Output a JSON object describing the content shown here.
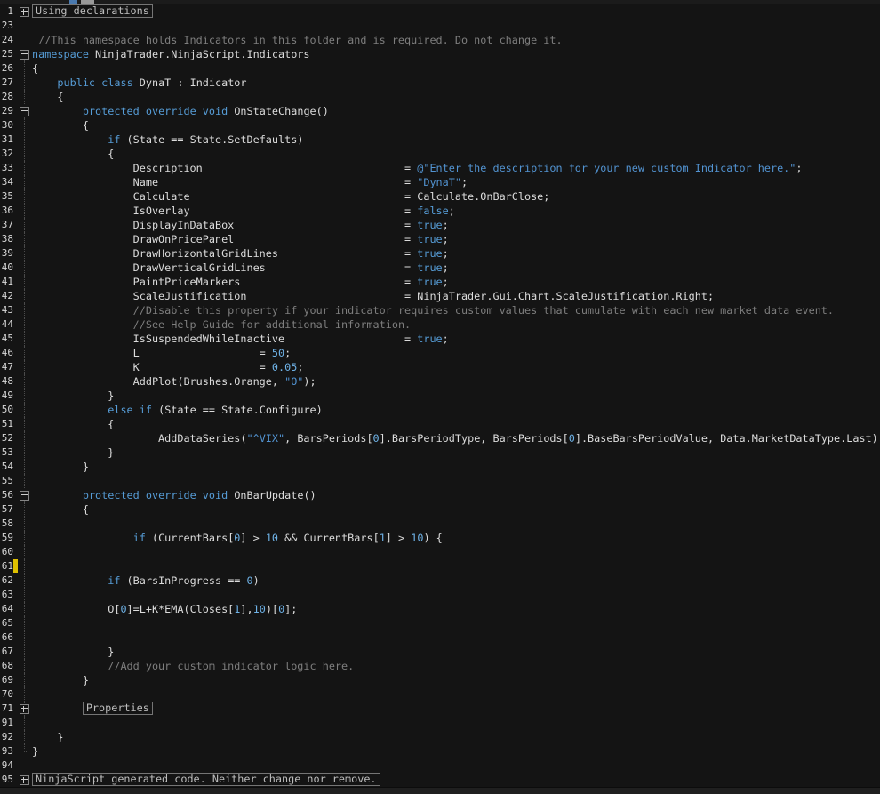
{
  "editor": {
    "colors": {
      "background": "#141414",
      "plain": "#dcdcdc",
      "keyword": "#569cd6",
      "string": "#5293d1",
      "number": "#6fb3e8",
      "comment": "#7e7e7e",
      "line_number": "#d8d8d8",
      "fold_border": "#858585",
      "fold_glyph": "#cccccc",
      "guide": "#4b4b4b",
      "boxed_text": "#bdbdbd",
      "boxed_border": "#757575",
      "change_marker": "#dfc000",
      "top_strip": "#1b1b1b",
      "bottom_strip": "#1f1f1f"
    },
    "collapsed_regions": [
      "Using declarations",
      "Properties",
      "NinjaScript generated code. Neither change nor remove."
    ],
    "lines": [
      {
        "num": "1",
        "fold": "plus",
        "tokens": [
          {
            "s": "Using declarations",
            "c": "boxed"
          }
        ]
      },
      {
        "num": "23",
        "fold": "",
        "tokens": []
      },
      {
        "num": "24",
        "fold": "",
        "tokens": [
          {
            "s": " //This namespace holds Indicators in this folder and is required. Do not change it.",
            "c": "com"
          }
        ]
      },
      {
        "num": "25",
        "fold": "minus",
        "tokens": [
          {
            "s": "namespace",
            "c": "kw"
          },
          {
            "s": " NinjaTrader.NinjaScript.Indicators",
            "c": "plain"
          }
        ]
      },
      {
        "num": "26",
        "fold": "line",
        "tokens": [
          {
            "s": "{",
            "c": "plain"
          }
        ]
      },
      {
        "num": "27",
        "fold": "line",
        "tokens": [
          {
            "s": "    ",
            "c": "plain"
          },
          {
            "s": "public",
            "c": "kw"
          },
          {
            "s": " ",
            "c": "plain"
          },
          {
            "s": "class",
            "c": "kw"
          },
          {
            "s": " DynaT : Indicator",
            "c": "plain"
          }
        ]
      },
      {
        "num": "28",
        "fold": "line",
        "tokens": [
          {
            "s": "    {",
            "c": "plain"
          }
        ]
      },
      {
        "num": "29",
        "fold": "minus",
        "tokens": [
          {
            "s": "        ",
            "c": "plain"
          },
          {
            "s": "protected",
            "c": "kw"
          },
          {
            "s": " ",
            "c": "plain"
          },
          {
            "s": "override",
            "c": "kw"
          },
          {
            "s": " ",
            "c": "plain"
          },
          {
            "s": "void",
            "c": "kw"
          },
          {
            "s": " OnStateChange()",
            "c": "plain"
          }
        ]
      },
      {
        "num": "30",
        "fold": "line",
        "tokens": [
          {
            "s": "        {",
            "c": "plain"
          }
        ]
      },
      {
        "num": "31",
        "fold": "line",
        "tokens": [
          {
            "s": "            ",
            "c": "plain"
          },
          {
            "s": "if",
            "c": "kw"
          },
          {
            "s": " (State == State.SetDefaults)",
            "c": "plain"
          }
        ]
      },
      {
        "num": "32",
        "fold": "line",
        "tokens": [
          {
            "s": "            {",
            "c": "plain"
          }
        ]
      },
      {
        "num": "33",
        "fold": "line",
        "tokens": [
          {
            "s": "                Description                                = ",
            "c": "plain"
          },
          {
            "s": "@\"Enter the description for your new custom Indicator here.\"",
            "c": "str"
          },
          {
            "s": ";",
            "c": "plain"
          }
        ]
      },
      {
        "num": "34",
        "fold": "line",
        "tokens": [
          {
            "s": "                Name                                       = ",
            "c": "plain"
          },
          {
            "s": "\"DynaT\"",
            "c": "str"
          },
          {
            "s": ";",
            "c": "plain"
          }
        ]
      },
      {
        "num": "35",
        "fold": "line",
        "tokens": [
          {
            "s": "                Calculate                                  = Calculate.OnBarClose;",
            "c": "plain"
          }
        ]
      },
      {
        "num": "36",
        "fold": "line",
        "tokens": [
          {
            "s": "                IsOverlay                                  = ",
            "c": "plain"
          },
          {
            "s": "false",
            "c": "kw"
          },
          {
            "s": ";",
            "c": "plain"
          }
        ]
      },
      {
        "num": "37",
        "fold": "line",
        "tokens": [
          {
            "s": "                DisplayInDataBox                           = ",
            "c": "plain"
          },
          {
            "s": "true",
            "c": "kw"
          },
          {
            "s": ";",
            "c": "plain"
          }
        ]
      },
      {
        "num": "38",
        "fold": "line",
        "tokens": [
          {
            "s": "                DrawOnPricePanel                           = ",
            "c": "plain"
          },
          {
            "s": "true",
            "c": "kw"
          },
          {
            "s": ";",
            "c": "plain"
          }
        ]
      },
      {
        "num": "39",
        "fold": "line",
        "tokens": [
          {
            "s": "                DrawHorizontalGridLines                    = ",
            "c": "plain"
          },
          {
            "s": "true",
            "c": "kw"
          },
          {
            "s": ";",
            "c": "plain"
          }
        ]
      },
      {
        "num": "40",
        "fold": "line",
        "tokens": [
          {
            "s": "                DrawVerticalGridLines                      = ",
            "c": "plain"
          },
          {
            "s": "true",
            "c": "kw"
          },
          {
            "s": ";",
            "c": "plain"
          }
        ]
      },
      {
        "num": "41",
        "fold": "line",
        "tokens": [
          {
            "s": "                PaintPriceMarkers                          = ",
            "c": "plain"
          },
          {
            "s": "true",
            "c": "kw"
          },
          {
            "s": ";",
            "c": "plain"
          }
        ]
      },
      {
        "num": "42",
        "fold": "line",
        "tokens": [
          {
            "s": "                ScaleJustification                         = NinjaTrader.Gui.Chart.ScaleJustification.Right;",
            "c": "plain"
          }
        ]
      },
      {
        "num": "43",
        "fold": "line",
        "tokens": [
          {
            "s": "                ",
            "c": "plain"
          },
          {
            "s": "//Disable this property if your indicator requires custom values that cumulate with each new market data event.",
            "c": "com"
          }
        ]
      },
      {
        "num": "44",
        "fold": "line",
        "tokens": [
          {
            "s": "                ",
            "c": "plain"
          },
          {
            "s": "//See Help Guide for additional information.",
            "c": "com"
          }
        ]
      },
      {
        "num": "45",
        "fold": "line",
        "tokens": [
          {
            "s": "                IsSuspendedWhileInactive                   = ",
            "c": "plain"
          },
          {
            "s": "true",
            "c": "kw"
          },
          {
            "s": ";",
            "c": "plain"
          }
        ]
      },
      {
        "num": "46",
        "fold": "line",
        "tokens": [
          {
            "s": "                L                   = ",
            "c": "plain"
          },
          {
            "s": "50",
            "c": "num"
          },
          {
            "s": ";",
            "c": "plain"
          }
        ]
      },
      {
        "num": "47",
        "fold": "line",
        "tokens": [
          {
            "s": "                K                   = ",
            "c": "plain"
          },
          {
            "s": "0.05",
            "c": "num"
          },
          {
            "s": ";",
            "c": "plain"
          }
        ]
      },
      {
        "num": "48",
        "fold": "line",
        "tokens": [
          {
            "s": "                AddPlot(Brushes.Orange, ",
            "c": "plain"
          },
          {
            "s": "\"O\"",
            "c": "str"
          },
          {
            "s": ");",
            "c": "plain"
          }
        ]
      },
      {
        "num": "49",
        "fold": "line",
        "tokens": [
          {
            "s": "            }",
            "c": "plain"
          }
        ]
      },
      {
        "num": "50",
        "fold": "line",
        "tokens": [
          {
            "s": "            ",
            "c": "plain"
          },
          {
            "s": "else",
            "c": "kw"
          },
          {
            "s": " ",
            "c": "plain"
          },
          {
            "s": "if",
            "c": "kw"
          },
          {
            "s": " (State == State.Configure)",
            "c": "plain"
          }
        ]
      },
      {
        "num": "51",
        "fold": "line",
        "tokens": [
          {
            "s": "            {",
            "c": "plain"
          }
        ]
      },
      {
        "num": "52",
        "fold": "line",
        "tokens": [
          {
            "s": "                    AddDataSeries(",
            "c": "plain"
          },
          {
            "s": "\"^VIX\"",
            "c": "str"
          },
          {
            "s": ", BarsPeriods[",
            "c": "plain"
          },
          {
            "s": "0",
            "c": "num"
          },
          {
            "s": "].BarsPeriodType, BarsPeriods[",
            "c": "plain"
          },
          {
            "s": "0",
            "c": "num"
          },
          {
            "s": "].BaseBarsPeriodValue, Data.MarketDataType.Last);",
            "c": "plain"
          }
        ]
      },
      {
        "num": "53",
        "fold": "line",
        "tokens": [
          {
            "s": "            }",
            "c": "plain"
          }
        ]
      },
      {
        "num": "54",
        "fold": "line",
        "tokens": [
          {
            "s": "        }",
            "c": "plain"
          }
        ]
      },
      {
        "num": "55",
        "fold": "line",
        "tokens": []
      },
      {
        "num": "56",
        "fold": "minus",
        "tokens": [
          {
            "s": "        ",
            "c": "plain"
          },
          {
            "s": "protected",
            "c": "kw"
          },
          {
            "s": " ",
            "c": "plain"
          },
          {
            "s": "override",
            "c": "kw"
          },
          {
            "s": " ",
            "c": "plain"
          },
          {
            "s": "void",
            "c": "kw"
          },
          {
            "s": " OnBarUpdate()",
            "c": "plain"
          }
        ]
      },
      {
        "num": "57",
        "fold": "line",
        "tokens": [
          {
            "s": "        {",
            "c": "plain"
          }
        ]
      },
      {
        "num": "58",
        "fold": "line",
        "tokens": []
      },
      {
        "num": "59",
        "fold": "line",
        "tokens": [
          {
            "s": "                ",
            "c": "plain"
          },
          {
            "s": "if",
            "c": "kw"
          },
          {
            "s": " (CurrentBars[",
            "c": "plain"
          },
          {
            "s": "0",
            "c": "num"
          },
          {
            "s": "] > ",
            "c": "plain"
          },
          {
            "s": "10",
            "c": "num"
          },
          {
            "s": " && CurrentBars[",
            "c": "plain"
          },
          {
            "s": "1",
            "c": "num"
          },
          {
            "s": "] > ",
            "c": "plain"
          },
          {
            "s": "10",
            "c": "num"
          },
          {
            "s": ") {",
            "c": "plain"
          }
        ]
      },
      {
        "num": "60",
        "fold": "line",
        "tokens": []
      },
      {
        "num": "61",
        "fold": "line",
        "marker": true,
        "tokens": []
      },
      {
        "num": "62",
        "fold": "line",
        "tokens": [
          {
            "s": "            ",
            "c": "plain"
          },
          {
            "s": "if",
            "c": "kw"
          },
          {
            "s": " (BarsInProgress == ",
            "c": "plain"
          },
          {
            "s": "0",
            "c": "num"
          },
          {
            "s": ")",
            "c": "plain"
          }
        ]
      },
      {
        "num": "63",
        "fold": "line",
        "tokens": []
      },
      {
        "num": "64",
        "fold": "line",
        "tokens": [
          {
            "s": "            O[",
            "c": "plain"
          },
          {
            "s": "0",
            "c": "num"
          },
          {
            "s": "]=L+K*EMA(Closes[",
            "c": "plain"
          },
          {
            "s": "1",
            "c": "num"
          },
          {
            "s": "],",
            "c": "plain"
          },
          {
            "s": "10",
            "c": "num"
          },
          {
            "s": ")[",
            "c": "plain"
          },
          {
            "s": "0",
            "c": "num"
          },
          {
            "s": "];",
            "c": "plain"
          }
        ]
      },
      {
        "num": "65",
        "fold": "line",
        "tokens": []
      },
      {
        "num": "66",
        "fold": "line",
        "tokens": []
      },
      {
        "num": "67",
        "fold": "line",
        "tokens": [
          {
            "s": "            }",
            "c": "plain"
          }
        ]
      },
      {
        "num": "68",
        "fold": "line",
        "tokens": [
          {
            "s": "            ",
            "c": "plain"
          },
          {
            "s": "//Add your custom indicator logic here.",
            "c": "com"
          }
        ]
      },
      {
        "num": "69",
        "fold": "line",
        "tokens": [
          {
            "s": "        }",
            "c": "plain"
          }
        ]
      },
      {
        "num": "70",
        "fold": "line",
        "tokens": []
      },
      {
        "num": "71",
        "fold": "plusline",
        "tokens": [
          {
            "s": "        ",
            "c": "plain"
          },
          {
            "s": "Properties",
            "c": "boxed"
          }
        ]
      },
      {
        "num": "91",
        "fold": "line",
        "tokens": []
      },
      {
        "num": "92",
        "fold": "line",
        "tokens": [
          {
            "s": "    }",
            "c": "plain"
          }
        ]
      },
      {
        "num": "93",
        "fold": "end",
        "tokens": [
          {
            "s": "}",
            "c": "plain"
          }
        ]
      },
      {
        "num": "94",
        "fold": "",
        "tokens": []
      },
      {
        "num": "95",
        "fold": "plus",
        "tokens": [
          {
            "s": "NinjaScript generated code. Neither change nor remove.",
            "c": "boxed"
          }
        ]
      }
    ]
  }
}
